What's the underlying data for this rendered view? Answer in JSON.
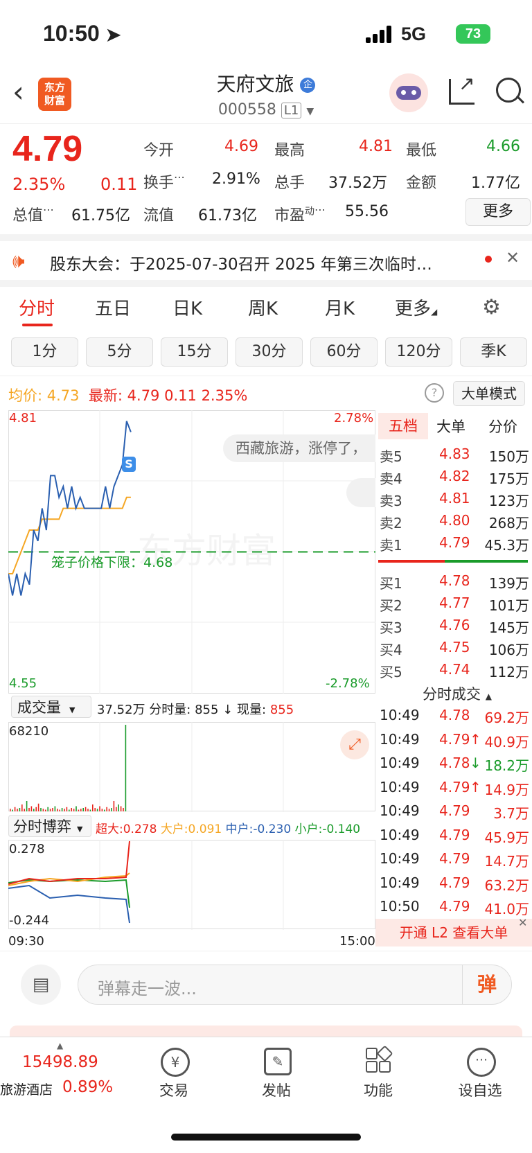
{
  "status": {
    "time": "10:50",
    "network": "5G",
    "battery": "73"
  },
  "header": {
    "name": "天府文旅",
    "code": "000558",
    "level": "L1",
    "logo_line1": "东方",
    "logo_line2": "财富"
  },
  "quote": {
    "price": "4.79",
    "change_pct": "2.35%",
    "change": "0.11",
    "open_label": "今开",
    "open": "4.69",
    "high_label": "最高",
    "high": "4.81",
    "low_label": "最低",
    "low": "4.66",
    "turnover_label": "换手",
    "turnover": "2.91%",
    "volume_label": "总手",
    "volume": "37.52万",
    "amount_label": "金额",
    "amount": "1.77亿",
    "total_value_label": "总值",
    "total_value": "61.75亿",
    "float_value_label": "流值",
    "float_value": "61.73亿",
    "pe_label": "市盈",
    "pe_sup": "动",
    "pe": "55.56",
    "more_label": "更多"
  },
  "notice": {
    "text": "股东大会：于2025-07-30召开 2025 年第三次临时…"
  },
  "tabs": [
    "分时",
    "五日",
    "日K",
    "周K",
    "月K",
    "更多"
  ],
  "sub_tabs": [
    "1分",
    "5分",
    "15分",
    "30分",
    "60分",
    "120分",
    "季K"
  ],
  "chart_info": {
    "avg_label": "均价:",
    "avg": "4.73",
    "last_label": "最新:",
    "last": "4.79",
    "change": "0.11",
    "change_pct": "2.35%",
    "mode": "大单模式"
  },
  "chart_data": {
    "type": "line",
    "x_start": "09:30",
    "x_end": "15:00",
    "ylim": [
      4.55,
      4.81
    ],
    "y_top_label": "4.81",
    "y_bottom_label": "4.55",
    "pct_top_label": "2.78%",
    "pct_bottom_label": "-2.78%",
    "series": [
      {
        "values": [
          4.66,
          4.64,
          4.66,
          4.64,
          4.66,
          4.65,
          4.7,
          4.69,
          4.72,
          4.7,
          4.75,
          4.75,
          4.73,
          4.74,
          4.72,
          4.74,
          4.72,
          4.73,
          4.72,
          4.72,
          4.72,
          4.72,
          4.72,
          4.74,
          4.72,
          4.74,
          4.75,
          4.76,
          4.8,
          4.79
        ]
      },
      {
        "values": [
          4.66,
          4.66,
          4.67,
          4.68,
          4.69,
          4.7,
          4.7,
          4.7,
          4.71,
          4.71,
          4.71,
          4.71,
          4.71,
          4.72,
          4.72,
          4.72,
          4.72,
          4.72,
          4.72,
          4.72,
          4.72,
          4.72,
          4.72,
          4.72,
          4.72,
          4.72,
          4.72,
          4.72,
          4.73,
          4.73
        ]
      }
    ],
    "limit_line": 4.68,
    "limit_label": "笼子价格下限：4.68",
    "s_marker": "S"
  },
  "bubble": {
    "text": "西藏旅游，涨停了，"
  },
  "volume": {
    "label": "成交量",
    "total": "37.52万",
    "minute_label": "分时量:",
    "minute": "855",
    "now_label": "现量:",
    "now": "855",
    "max_label": "68210",
    "bars": [
      3,
      2,
      5,
      3,
      4,
      8,
      3,
      12,
      4,
      6,
      3,
      5,
      9,
      4,
      3,
      2,
      5,
      3,
      4,
      6,
      3,
      2,
      4,
      3,
      5,
      2,
      4,
      3,
      6,
      2,
      3,
      4,
      5,
      3,
      2,
      8,
      4,
      3,
      6,
      3,
      2,
      5,
      3,
      4,
      12,
      5,
      8,
      6,
      4,
      100
    ]
  },
  "game": {
    "label": "分时博弈",
    "super_label": "超大:",
    "super": "0.278",
    "big_label": "大户:",
    "big": "0.091",
    "mid_label": "中户:",
    "mid": "-0.230",
    "small_label": "小户:",
    "small": "-0.140",
    "top": "0.278",
    "bottom": "-0.244"
  },
  "orderbook": {
    "tabs": [
      "五档",
      "大单",
      "分价"
    ],
    "asks": [
      {
        "label": "卖5",
        "price": "4.83",
        "vol": "150万"
      },
      {
        "label": "卖4",
        "price": "4.82",
        "vol": "175万"
      },
      {
        "label": "卖3",
        "price": "4.81",
        "vol": "123万"
      },
      {
        "label": "卖2",
        "price": "4.80",
        "vol": "268万"
      },
      {
        "label": "卖1",
        "price": "4.79",
        "vol": "45.3万"
      }
    ],
    "bids": [
      {
        "label": "买1",
        "price": "4.78",
        "vol": "139万"
      },
      {
        "label": "买2",
        "price": "4.77",
        "vol": "101万"
      },
      {
        "label": "买3",
        "price": "4.76",
        "vol": "145万"
      },
      {
        "label": "买4",
        "price": "4.75",
        "vol": "106万"
      },
      {
        "label": "买5",
        "price": "4.74",
        "vol": "112万"
      }
    ]
  },
  "trades": {
    "title": "分时成交",
    "rows": [
      {
        "time": "10:49",
        "price": "4.78",
        "arrow": "",
        "vol": "69.2万",
        "color": "red"
      },
      {
        "time": "10:49",
        "price": "4.79",
        "arrow": "↑",
        "vol": "40.9万",
        "color": "red"
      },
      {
        "time": "10:49",
        "price": "4.78",
        "arrow": "↓",
        "vol": "18.2万",
        "color": "green"
      },
      {
        "time": "10:49",
        "price": "4.79",
        "arrow": "↑",
        "vol": "14.9万",
        "color": "red"
      },
      {
        "time": "10:49",
        "price": "4.79",
        "arrow": "",
        "vol": "3.7万",
        "color": "red"
      },
      {
        "time": "10:49",
        "price": "4.79",
        "arrow": "",
        "vol": "45.9万",
        "color": "red"
      },
      {
        "time": "10:49",
        "price": "4.79",
        "arrow": "",
        "vol": "14.7万",
        "color": "red"
      },
      {
        "time": "10:49",
        "price": "4.79",
        "arrow": "",
        "vol": "63.2万",
        "color": "red"
      },
      {
        "time": "10:50",
        "price": "4.79",
        "arrow": "",
        "vol": "41.0万",
        "color": "red"
      }
    ],
    "l2_banner": "开通 L2 查看大单"
  },
  "comment": {
    "placeholder": "弹幕走一波...",
    "send": "弹"
  },
  "bottom_nav": {
    "index_value": "15498.89",
    "index_name": "旅游酒店",
    "index_pct": "0.89%",
    "items": [
      "交易",
      "发帖",
      "功能",
      "设自选"
    ]
  },
  "colors": {
    "red": "#e8251c",
    "green": "#1a9b2a",
    "avg_line": "#f5a623",
    "price_line": "#2a5fb0"
  }
}
